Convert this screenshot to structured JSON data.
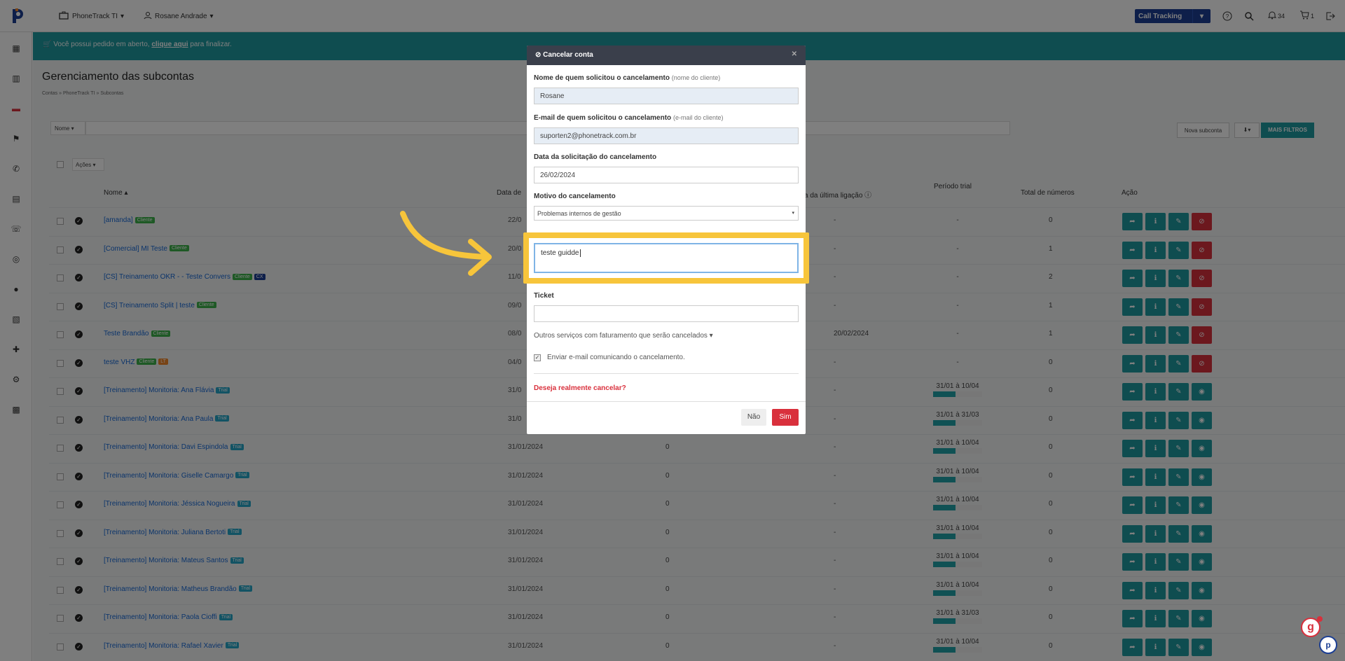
{
  "topbar": {
    "company": "PhoneTrack TI",
    "user": "Rosane Andrade",
    "product_button": "Call Tracking",
    "notifications_count": "34",
    "cart_count": "1"
  },
  "banner": {
    "text_before": " Você possui pedido em aberto, ",
    "link": "clique aqui",
    "text_after": " para finalizar."
  },
  "page": {
    "title": "Gerenciamento das subcontas",
    "breadcrumb": [
      "Contas",
      "PhoneTrack TI",
      "Subcontas"
    ],
    "filter_select": "Nome",
    "actions_select": "Ações",
    "new_subaccount": "Nova subconta",
    "more_filters": "MAIS FILTROS",
    "columns": {
      "name": "Nome",
      "date": "Data de",
      "last_call": "a da última ligação",
      "trial": "Período trial",
      "total_numbers": "Total de números",
      "action": "Ação"
    }
  },
  "rows": [
    {
      "name": "[amanda]",
      "badges": [
        [
          "Cliente",
          "green"
        ]
      ],
      "date": "22/0",
      "zero": "",
      "last": "-",
      "trial": "-",
      "trial_pct": 0,
      "total": "0",
      "last_btn": "red"
    },
    {
      "name": "[Comercial] MI Teste",
      "badges": [
        [
          "Cliente",
          "green"
        ]
      ],
      "date": "20/0",
      "zero": "",
      "last": "-",
      "trial": "-",
      "trial_pct": 0,
      "total": "1",
      "last_btn": "red"
    },
    {
      "name": "[CS] Treinamento OKR - - Teste Convers",
      "badges": [
        [
          "Cliente",
          "green"
        ],
        [
          "CX",
          "blue"
        ]
      ],
      "date": "11/0",
      "zero": "",
      "last": "-",
      "trial": "-",
      "trial_pct": 0,
      "total": "2",
      "last_btn": "red"
    },
    {
      "name": "[CS] Treinamento Split | teste",
      "badges": [
        [
          "Cliente",
          "green"
        ]
      ],
      "date": "09/0",
      "zero": "",
      "last": "-",
      "trial": "-",
      "trial_pct": 0,
      "total": "1",
      "last_btn": "red"
    },
    {
      "name": "Teste Brandão",
      "badges": [
        [
          "Cliente",
          "green"
        ]
      ],
      "date": "08/0",
      "zero": "",
      "last": "20/02/2024",
      "trial": "-",
      "trial_pct": 0,
      "total": "1",
      "last_btn": "red"
    },
    {
      "name": "teste VHZ",
      "badges": [
        [
          "Cliente",
          "green"
        ],
        [
          "LT",
          "orange"
        ]
      ],
      "date": "04/0",
      "zero": "",
      "last": "-",
      "trial": "-",
      "trial_pct": 0,
      "total": "0",
      "last_btn": "red"
    },
    {
      "name": "[Treinamento] Monitoria: Ana Flávia",
      "badges": [
        [
          "Trial",
          "teal"
        ]
      ],
      "date": "31/0",
      "zero": "",
      "last": "-",
      "trial": "31/01 à 10/04",
      "trial_pct": 0.45,
      "total": "0",
      "last_btn": "teal"
    },
    {
      "name": "[Treinamento] Monitoria: Ana Paula",
      "badges": [
        [
          "Trial",
          "teal"
        ]
      ],
      "date": "31/0",
      "zero": "",
      "last": "-",
      "trial": "31/01 à 31/03",
      "trial_pct": 0.45,
      "total": "0",
      "last_btn": "teal"
    },
    {
      "name": "[Treinamento] Monitoria: Davi Espindola",
      "badges": [
        [
          "Trial",
          "teal"
        ]
      ],
      "date": "31/01/2024",
      "zero": "0",
      "last": "-",
      "trial": "31/01 à 10/04",
      "trial_pct": 0.45,
      "total": "0",
      "last_btn": "teal"
    },
    {
      "name": "[Treinamento] Monitoria: Giselle Camargo",
      "badges": [
        [
          "Trial",
          "teal"
        ]
      ],
      "date": "31/01/2024",
      "zero": "0",
      "last": "-",
      "trial": "31/01 à 10/04",
      "trial_pct": 0.45,
      "total": "0",
      "last_btn": "teal"
    },
    {
      "name": "[Treinamento] Monitoria: Jéssica Nogueira",
      "badges": [
        [
          "Trial",
          "teal"
        ]
      ],
      "date": "31/01/2024",
      "zero": "0",
      "last": "-",
      "trial": "31/01 à 10/04",
      "trial_pct": 0.45,
      "total": "0",
      "last_btn": "teal"
    },
    {
      "name": "[Treinamento] Monitoria: Juliana Bertoti",
      "badges": [
        [
          "Trial",
          "teal"
        ]
      ],
      "date": "31/01/2024",
      "zero": "0",
      "last": "-",
      "trial": "31/01 à 10/04",
      "trial_pct": 0.45,
      "total": "0",
      "last_btn": "teal"
    },
    {
      "name": "[Treinamento] Monitoria: Mateus Santos",
      "badges": [
        [
          "Trial",
          "teal"
        ]
      ],
      "date": "31/01/2024",
      "zero": "0",
      "last": "-",
      "trial": "31/01 à 10/04",
      "trial_pct": 0.45,
      "total": "0",
      "last_btn": "teal"
    },
    {
      "name": "[Treinamento] Monitoria: Matheus Brandão",
      "badges": [
        [
          "Trial",
          "teal"
        ]
      ],
      "date": "31/01/2024",
      "zero": "0",
      "last": "-",
      "trial": "31/01 à 10/04",
      "trial_pct": 0.45,
      "total": "0",
      "last_btn": "teal"
    },
    {
      "name": "[Treinamento] Monitoria: Paola Cioffi",
      "badges": [
        [
          "Trial",
          "teal"
        ]
      ],
      "date": "31/01/2024",
      "zero": "0",
      "last": "-",
      "trial": "31/01 à 31/03",
      "trial_pct": 0.45,
      "total": "0",
      "last_btn": "teal"
    },
    {
      "name": "[Treinamento] Monitoria: Rafael Xavier",
      "badges": [
        [
          "Trial",
          "teal"
        ]
      ],
      "date": "31/01/2024",
      "zero": "0",
      "last": "-",
      "trial": "31/01 à 10/04",
      "trial_pct": 0.45,
      "total": "0",
      "last_btn": "teal"
    }
  ],
  "modal": {
    "title": "Cancelar conta",
    "requester_label": "Nome de quem solicitou o cancelamento",
    "requester_hint": "(nome do cliente)",
    "requester_value": "Rosane",
    "email_label": "E-mail de quem solicitou o cancelamento",
    "email_hint": "(e-mail do cliente)",
    "email_value": "suporten2@phonetrack.com.br",
    "date_label": "Data da solicitação do cancelamento",
    "date_value": "26/02/2024",
    "reason_label": "Motivo do cancelamento",
    "reason_value": "Problemas internos de gestão",
    "notes_value": "teste guidde",
    "ticket_label": "Ticket",
    "ticket_value": "",
    "other_services": "Outros serviços com faturamento que serão cancelados ▾",
    "send_email": "Enviar e-mail comunicando o cancelamento.",
    "confirm_question": "Deseja realmente cancelar?",
    "no": "Não",
    "yes": "Sim"
  },
  "colors": {
    "teal": "#1f9aa0",
    "highlight": "#f7c53b",
    "danger": "#d9303c",
    "navy": "#1c3f94"
  }
}
